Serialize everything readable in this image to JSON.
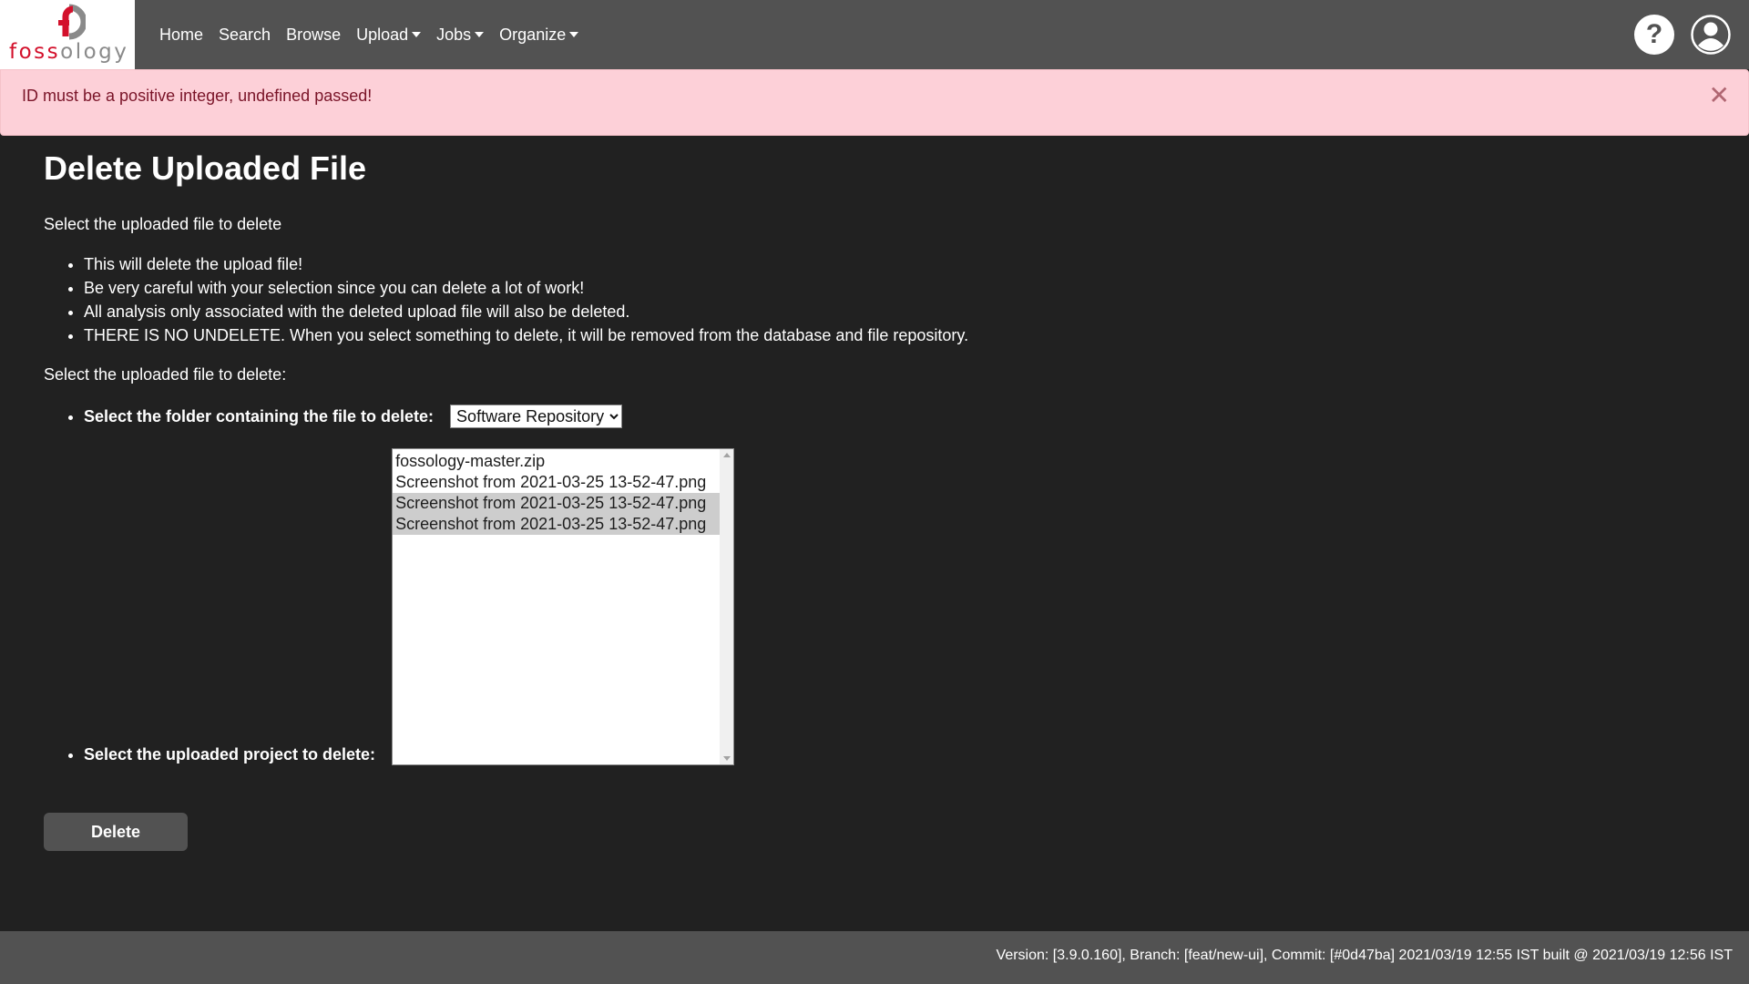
{
  "brand": {
    "logo_text_red": "foss",
    "logo_text_gray": "ology",
    "colors": {
      "red": "#d3102b",
      "gray": "#8a8a8a"
    }
  },
  "nav": {
    "items": [
      {
        "label": "Home",
        "dropdown": false
      },
      {
        "label": "Search",
        "dropdown": false
      },
      {
        "label": "Browse",
        "dropdown": false
      },
      {
        "label": "Upload",
        "dropdown": true
      },
      {
        "label": "Jobs",
        "dropdown": true
      },
      {
        "label": "Organize",
        "dropdown": true
      }
    ],
    "help_icon": "?",
    "user_icon": "user-circle-icon"
  },
  "alert": {
    "message": "ID must be a positive integer, undefined passed!",
    "close_symbol": "✕",
    "color": "#fdd0d8"
  },
  "page": {
    "title": "Delete Uploaded File",
    "intro": "Select the uploaded file to delete",
    "warnings": [
      "This will delete the upload file!",
      "Be very careful with your selection since you can delete a lot of work!",
      "All analysis only associated with the deleted upload file will also be deleted.",
      "THERE IS NO UNDELETE. When you select something to delete, it will be removed from the database and file repository."
    ],
    "select_intro": "Select the uploaded file to delete:",
    "folder_label": "Select the folder containing the file to delete:",
    "folder_selected": "Software Repository",
    "project_label": "Select the uploaded project to delete:",
    "uploads": [
      {
        "name": "fossology-master.zip",
        "selected": false
      },
      {
        "name": "Screenshot from 2021-03-25 13-52-47.png",
        "selected": false
      },
      {
        "name": "Screenshot from 2021-03-25 13-52-47.png",
        "selected": true
      },
      {
        "name": "Screenshot from 2021-03-25 13-52-47.png",
        "selected": true
      }
    ],
    "delete_label": "Delete"
  },
  "footer": {
    "text": "Version: [3.9.0.160], Branch: [feat/new-ui], Commit: [#0d47ba] 2021/03/19 12:55 IST built @ 2021/03/19 12:56 IST"
  }
}
